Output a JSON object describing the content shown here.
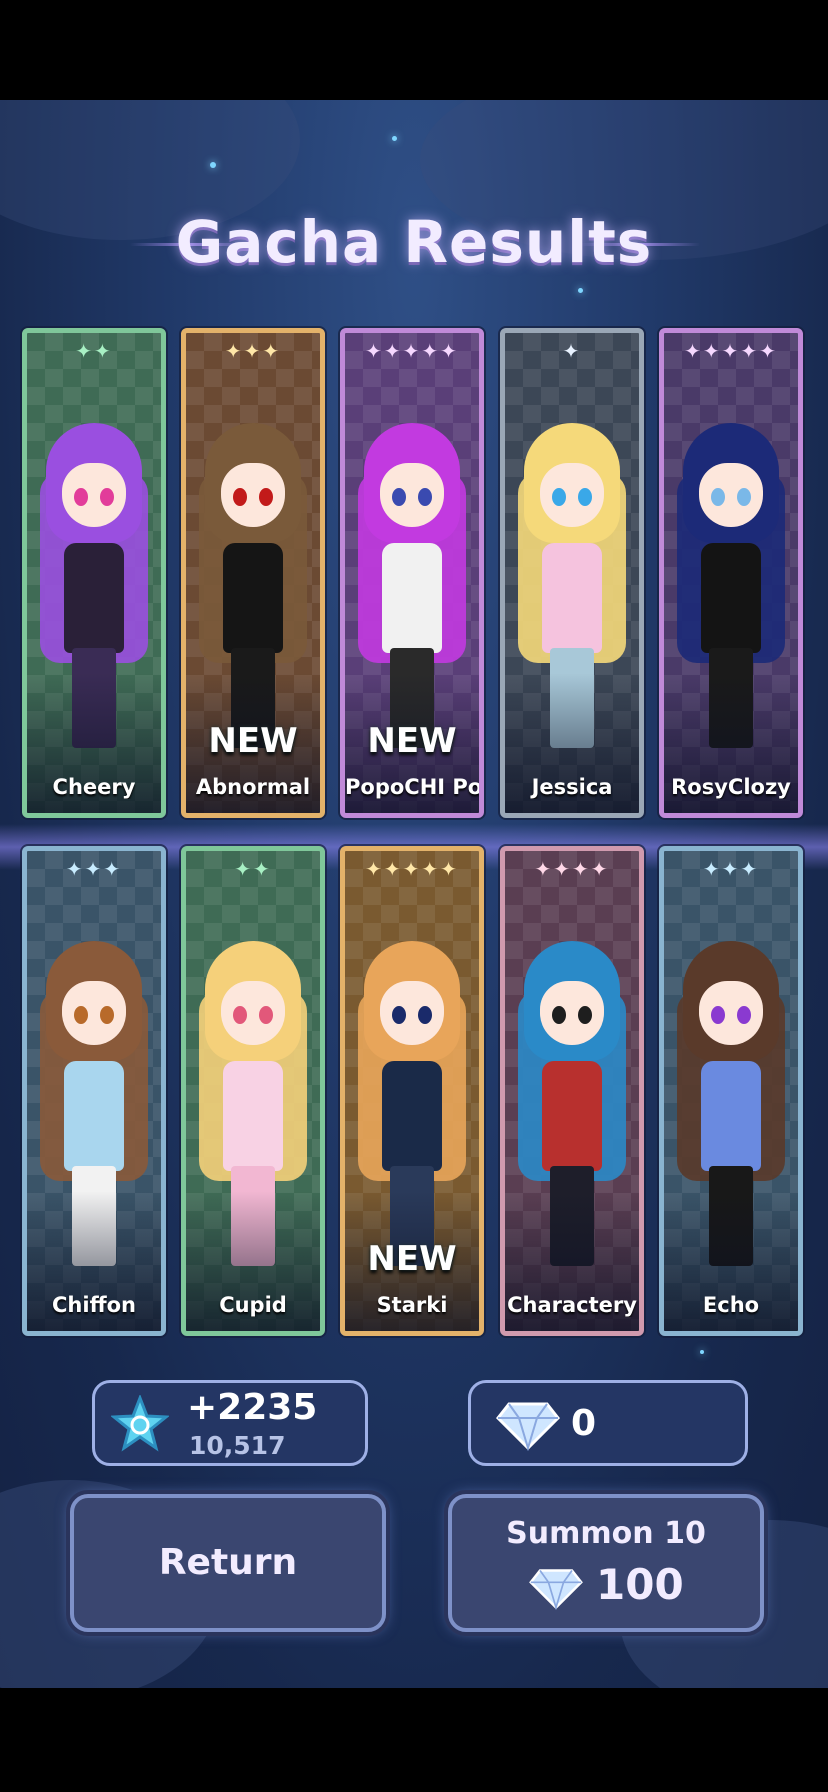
{
  "title": "Gacha Results",
  "cards": [
    {
      "name": "Cheery",
      "stars": "✦✦",
      "new": "",
      "frame": "#7fc79a",
      "bg": "#3f6b55",
      "star_color": "#a8f0c4",
      "hair": "#9a4fe0",
      "body": "#2a2038",
      "legs": "#3a2c55",
      "eye": "#e23c9a"
    },
    {
      "name": "Abnormal",
      "stars": "✦✦✦",
      "new": "NEW",
      "frame": "#e3b26a",
      "bg": "#6b4a33",
      "star_color": "#ffe7a8",
      "hair": "#7a5a3a",
      "body": "#151515",
      "legs": "#1a1a1a",
      "eye": "#c21a1a"
    },
    {
      "name": "PopoCHI Po",
      "stars": "✦✦✦✦✦",
      "new": "NEW",
      "frame": "#c08ad8",
      "bg": "#5a3f78",
      "star_color": "#f6d8ff",
      "hair": "#c23ae0",
      "body": "#f1f1f1",
      "legs": "#2a2a2a",
      "eye": "#3a4ab0"
    },
    {
      "name": "Jessica",
      "stars": "✦",
      "new": "",
      "frame": "#9aa7b6",
      "bg": "#3c4756",
      "star_color": "#e8f2ff",
      "hair": "#f5d97a",
      "body": "#f5c3de",
      "legs": "#a8c8d8",
      "eye": "#3aa8e8"
    },
    {
      "name": "RosyClozy",
      "stars": "✦✦✦✦✦",
      "new": "",
      "frame": "#c08ad8",
      "bg": "#4a3a68",
      "star_color": "#f6d8ff",
      "hair": "#1c2a78",
      "body": "#141414",
      "legs": "#1a1a1a",
      "eye": "#7ab8e8"
    },
    {
      "name": "Chiffon",
      "stars": "✦✦✦",
      "new": "",
      "frame": "#8ab4d0",
      "bg": "#3a5468",
      "star_color": "#c8ecff",
      "hair": "#8a5a3a",
      "body": "#a9d6ee",
      "legs": "#f2f2f2",
      "eye": "#b86a2a"
    },
    {
      "name": "Cupid",
      "stars": "✦✦",
      "new": "",
      "frame": "#7fc79a",
      "bg": "#3f6b55",
      "star_color": "#a8f0c4",
      "hair": "#f5d07a",
      "body": "#f8d2e4",
      "legs": "#f2b7d2",
      "eye": "#e2587a"
    },
    {
      "name": "Starki",
      "stars": "✦✦✦✦✦",
      "new": "NEW",
      "frame": "#e3b26a",
      "bg": "#7a5a30",
      "star_color": "#ffe7a8",
      "hair": "#e8a55a",
      "body": "#1a2a48",
      "legs": "#2a3a5a",
      "eye": "#1a2a6a"
    },
    {
      "name": "Charactery",
      "stars": "✦✦✦✦",
      "new": "",
      "frame": "#d09aae",
      "bg": "#5a3e52",
      "star_color": "#ffd8e8",
      "hair": "#2a8ac8",
      "body": "#b8302e",
      "legs": "#1e1e2a",
      "eye": "#1e1e1e"
    },
    {
      "name": "Echo",
      "stars": "✦✦✦",
      "new": "",
      "frame": "#8ab4d0",
      "bg": "#3a5468",
      "star_color": "#c8ecff",
      "hair": "#5a3a2a",
      "body": "#6a8ae0",
      "legs": "#181818",
      "eye": "#8a3ad0"
    }
  ],
  "star_reward": {
    "gained": "+2235",
    "total": "10,517"
  },
  "diamonds": {
    "count": "0"
  },
  "buttons": {
    "return": "Return",
    "summon_label": "Summon 10",
    "summon_cost": "100"
  },
  "colors": {
    "accent": "#9eb0e6",
    "title": "#f2ecff",
    "gem": "#cfe6ff"
  }
}
